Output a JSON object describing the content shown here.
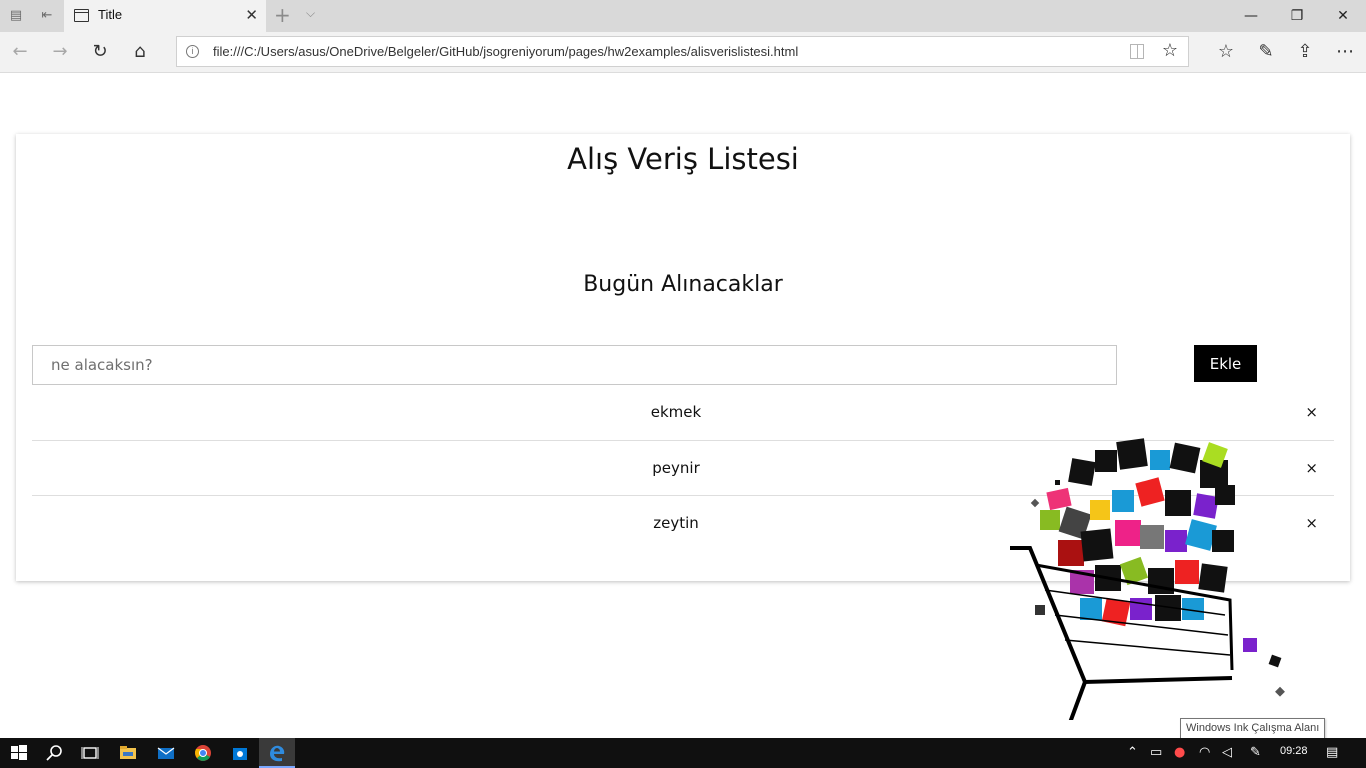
{
  "browser": {
    "tab_title": "Title",
    "tab_close": "✕",
    "new_tab": "+",
    "tab_menu": "⌵",
    "url": "file:///C:/Users/asus/OneDrive/Belgeler/GitHub/jsogreniyorum/pages/hw2examples/alisverislistesi.html",
    "window_controls": {
      "minimize": "—",
      "restore": "❐",
      "close": "✕"
    },
    "nav_glyphs": {
      "back": "←",
      "forward": "→",
      "refresh": "↻",
      "home": "⌂",
      "info": "i",
      "star": "☆",
      "favorites": "☆",
      "notes": "✎",
      "share": "⇪",
      "more": "⋯"
    }
  },
  "page": {
    "title": "Alış Veriş Listesi",
    "subtitle": "Bugün Alınacaklar",
    "input_placeholder": "ne alacaksın?",
    "input_value": "",
    "add_button": "Ekle",
    "items": [
      {
        "label": "ekmek",
        "remove": "×"
      },
      {
        "label": "peynir",
        "remove": "×"
      },
      {
        "label": "zeytin",
        "remove": "×"
      }
    ]
  },
  "tooltip": "Windows Ink Çalışma Alanı",
  "taskbar": {
    "clock": "09:28",
    "icons": [
      "windows-start-icon",
      "search-icon",
      "task-view-icon",
      "file-explorer-icon",
      "mail-icon",
      "chrome-icon",
      "store-icon",
      "edge-icon"
    ]
  },
  "colors": {
    "accent_button": "#000000",
    "tabbar": "#d9d9d9",
    "taskbar": "#101010"
  }
}
